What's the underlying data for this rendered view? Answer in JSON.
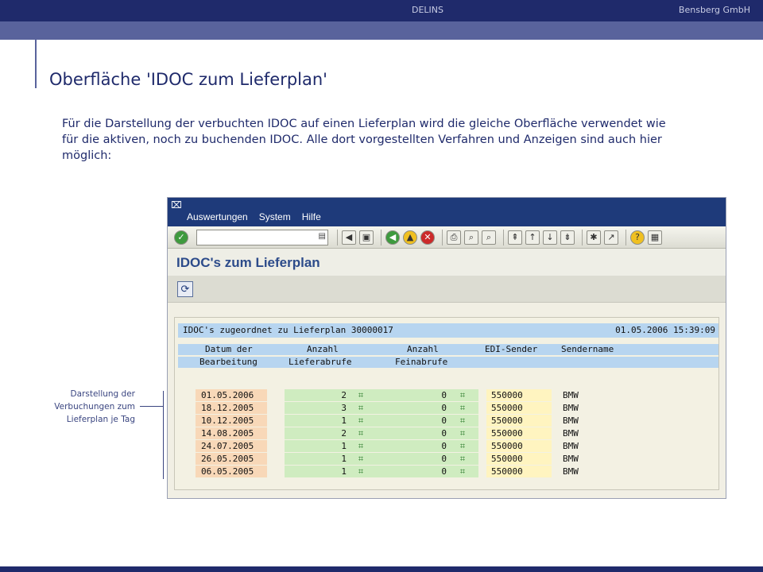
{
  "header": {
    "center_label": "DELINS",
    "company": "Bensberg GmbH"
  },
  "slide": {
    "title": "Oberfläche 'IDOC zum Lieferplan'",
    "intro": "Für die Darstellung der verbuchten IDOC auf einen Lieferplan wird die gleiche Oberfläche verwendet wie für die aktiven, noch zu buchenden IDOC. Alle dort vorgestellten Verfahren und Anzeigen sind auch hier möglich:",
    "side_note": "Darstellung der Verbuchungen zum Lieferplan je Tag"
  },
  "sap": {
    "menu": [
      "Auswertungen",
      "System",
      "Hilfe"
    ],
    "command_field": {
      "value": ""
    },
    "screen_title": "IDOC's zum Lieferplan",
    "list": {
      "header_left": "IDOC's zugeordnet zu Lieferplan 30000017",
      "header_right": "01.05.2006 15:39:09",
      "columns_line1": [
        "Datum der",
        "Anzahl",
        "Anzahl",
        "EDI-Sender",
        "Sendername"
      ],
      "columns_line2": [
        "Bearbeitung",
        "Lieferabrufe",
        "Feinabrufe",
        "",
        ""
      ],
      "rows": [
        {
          "date": "01.05.2006",
          "lieferabrufe": "2",
          "feinabrufe": "0",
          "edi_sender": "550000",
          "sendername": "BMW"
        },
        {
          "date": "18.12.2005",
          "lieferabrufe": "3",
          "feinabrufe": "0",
          "edi_sender": "550000",
          "sendername": "BMW"
        },
        {
          "date": "10.12.2005",
          "lieferabrufe": "1",
          "feinabrufe": "0",
          "edi_sender": "550000",
          "sendername": "BMW"
        },
        {
          "date": "14.08.2005",
          "lieferabrufe": "2",
          "feinabrufe": "0",
          "edi_sender": "550000",
          "sendername": "BMW"
        },
        {
          "date": "24.07.2005",
          "lieferabrufe": "1",
          "feinabrufe": "0",
          "edi_sender": "550000",
          "sendername": "BMW"
        },
        {
          "date": "26.05.2005",
          "lieferabrufe": "1",
          "feinabrufe": "0",
          "edi_sender": "550000",
          "sendername": "BMW"
        },
        {
          "date": "06.05.2005",
          "lieferabrufe": "1",
          "feinabrufe": "0",
          "edi_sender": "550000",
          "sendername": "BMW"
        }
      ]
    }
  },
  "colors": {
    "dark_blue": "#1f2a6b",
    "mid_blue": "#59639c",
    "sap_header_blue": "#b7d5f0",
    "date_cell": "#f8d8b8",
    "num_cell": "#cfecc0",
    "edi_cell": "#fff4c0"
  }
}
